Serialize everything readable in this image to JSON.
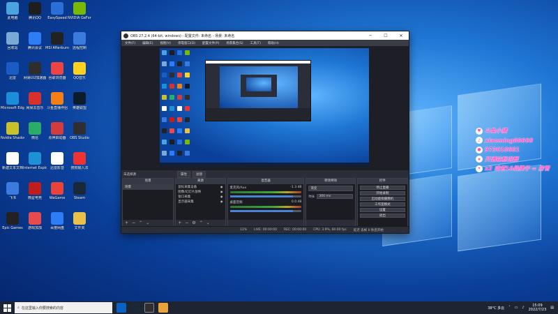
{
  "obs": {
    "title": "OBS 27.2.4 (64-bit, windows) - 配置文件: 未命名 - 场景: 未命名",
    "menu": [
      "文件(F)",
      "编辑(E)",
      "视图(V)",
      "停靠窗口(D)",
      "配置文件(P)",
      "场景集合(S)",
      "工具(T)",
      "帮助(H)"
    ],
    "current_scene_label": "未选择源",
    "scene_bar_buttons": [
      "属性",
      "滤镜"
    ],
    "docks": {
      "scenes_title": "场景",
      "scenes": [
        "场景"
      ],
      "sources_title": "来源",
      "sources": [
        "鼠标采集设备",
        "图像/幻灯片放映",
        "窗口采集",
        "显示器采集"
      ],
      "mixer_title": "混音器",
      "mixer": [
        {
          "name": "麦克风/Aux",
          "db": "-1.3 dB"
        },
        {
          "name": "桌面音频",
          "db": "0.0 dB"
        }
      ],
      "transitions_title": "转场特效",
      "transition_value": "渐变",
      "duration_label": "时长",
      "duration_value": "300 ms",
      "controls_title": "控件",
      "controls": [
        "停止直播",
        "开始录制",
        "启动虚拟摄像机",
        "工作室模式",
        "设置",
        "退出"
      ]
    },
    "status": {
      "dropped": "12%",
      "live": "LIVE: 00:00:00",
      "rec": "REC: 00:00:00",
      "cpu": "CPU: 3.9%, 60.00 fps",
      "bitrate": "延迟 丢帧 0 秒后开始"
    }
  },
  "desktop_icons": [
    {
      "label": "此电脑",
      "color": "#4aa3df"
    },
    {
      "label": "腾讯QQ",
      "color": "#1e1e1e"
    },
    {
      "label": "EasySpeed",
      "color": "#2a6fd6"
    },
    {
      "label": "NVIDIA GeForce",
      "color": "#76b900"
    },
    {
      "label": "回收站",
      "color": "#7aa9d6"
    },
    {
      "label": "腾讯会议",
      "color": "#2e7cf6"
    },
    {
      "label": "MSI Afterburner",
      "color": "#222"
    },
    {
      "label": "远程控制",
      "color": "#3a7be0"
    },
    {
      "label": "迅雷",
      "color": "#1a5cc4"
    },
    {
      "label": "网易UU加速器",
      "color": "#2e2e2e"
    },
    {
      "label": "谷歌浏览器",
      "color": "#e44"
    },
    {
      "label": "QQ音乐",
      "color": "#ffd21e"
    },
    {
      "label": "Microsoft Edge",
      "color": "#1c8dd9"
    },
    {
      "label": "网易云音乐",
      "color": "#d8302a"
    },
    {
      "label": "斗鱼直播伴侣",
      "color": "#f57f17"
    },
    {
      "label": "英雄联盟",
      "color": "#0d1c2c"
    },
    {
      "label": "Nvidia ShadowPlay",
      "color": "#c9c02a"
    },
    {
      "label": "微信",
      "color": "#2aae67"
    },
    {
      "label": "原神启动器",
      "color": "#d23c3c"
    },
    {
      "label": "OBS Studio",
      "color": "#302e31"
    },
    {
      "label": "新建文本文档",
      "color": "#fff"
    },
    {
      "label": "Internet Explorer",
      "color": "#1e90d6"
    },
    {
      "label": "迅雷影音",
      "color": "#fff"
    },
    {
      "label": "搜狗输入法",
      "color": "#e33"
    },
    {
      "label": "飞书",
      "color": "#3a7be0"
    },
    {
      "label": "微星电竞",
      "color": "#c21d1d"
    },
    {
      "label": "WeGame",
      "color": "#e8443a"
    },
    {
      "label": "Steam",
      "color": "#1b2838"
    },
    {
      "label": "Epic Games",
      "color": "#222"
    },
    {
      "label": "游戏加加",
      "color": "#e84b4b"
    },
    {
      "label": "百度网盘",
      "color": "#2e7cf6"
    },
    {
      "label": "文件夹",
      "color": "#e8c04a"
    }
  ],
  "overlay": [
    "斗鱼小猪",
    "xiaoming88668",
    "973018681",
    "开通钻粉进群",
    "x2 或者16级牌子 = 房管"
  ],
  "taskbar": {
    "search_placeholder": "在这里输入你要搜索的内容",
    "weather": "38°C 多云",
    "time": "15:09",
    "date": "2022/7/23"
  }
}
